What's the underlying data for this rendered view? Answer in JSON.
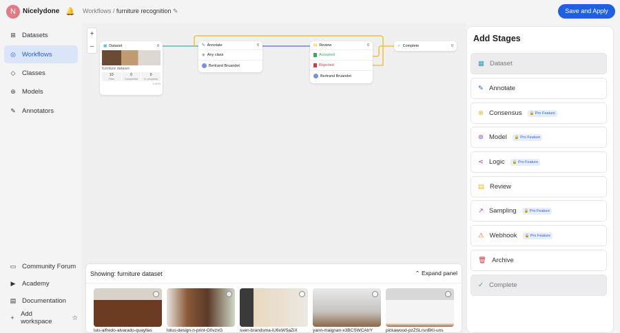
{
  "header": {
    "avatar": "N",
    "org": "Nicelydone",
    "crumb_root": "Workflows /",
    "crumb_current": "furniture recognition",
    "save": "Save and Apply"
  },
  "sidebar": {
    "items": [
      {
        "label": "Datasets",
        "icon": "⊞"
      },
      {
        "label": "Workflows",
        "icon": "◎"
      },
      {
        "label": "Classes",
        "icon": "◇"
      },
      {
        "label": "Models",
        "icon": "⊛"
      },
      {
        "label": "Annotators",
        "icon": "✎"
      }
    ],
    "bottom": [
      {
        "label": "Community Forum",
        "icon": "▭"
      },
      {
        "label": "Academy",
        "icon": "▶"
      },
      {
        "label": "Documentation",
        "icon": "▤"
      },
      {
        "label": "Add workspace",
        "icon": "+"
      }
    ]
  },
  "canvas": {
    "zoom_in": "+",
    "zoom_out": "–",
    "dataset": {
      "title": "Dataset",
      "count": "0",
      "name": "furniture dataset",
      "stats": [
        {
          "v": "10",
          "l": "Files"
        },
        {
          "v": "0",
          "l": "Completed"
        },
        {
          "v": "0",
          "l": "In progress"
        }
      ],
      "progress": "0.00%"
    },
    "annotate": {
      "title": "Annotate",
      "count": "0",
      "class": "Any class",
      "user": "Bertrand Bruandet"
    },
    "review": {
      "title": "Review",
      "count": "0",
      "accepted": "Accepted",
      "rejected": "Rejected",
      "user": "Bertrand Bruandet"
    },
    "complete": {
      "title": "Complete",
      "count": "0"
    }
  },
  "panel": {
    "showing": "Showing:",
    "dataset": "furniture dataset",
    "expand": "Expand panel",
    "files": [
      "luis-alfredo-alvarado-quayllas",
      "lotus-design-n-print-O0vzxG",
      "sven-brandsma-iU6xWSaZiX",
      "yann-maignan-x3BCSWCAtrY",
      "pickawood-pzZSLrsnBKl-uns"
    ]
  },
  "stages": {
    "title": "Add Stages",
    "pro": "Pro Feature",
    "items": [
      {
        "label": "Dataset",
        "color": "#2aa0b8",
        "pro": false
      },
      {
        "label": "Annotate",
        "color": "#2b5ed8",
        "pro": false
      },
      {
        "label": "Consensus",
        "color": "#e8b82a",
        "pro": true
      },
      {
        "label": "Model",
        "color": "#8a44d8",
        "pro": true
      },
      {
        "label": "Logic",
        "color": "#c23ad0",
        "pro": true
      },
      {
        "label": "Review",
        "color": "#e8b82a",
        "pro": false
      },
      {
        "label": "Sampling",
        "color": "#c23ad0",
        "pro": true
      },
      {
        "label": "Webhook",
        "color": "#e8703a",
        "pro": true
      },
      {
        "label": "Archive",
        "color": "#d83a3a",
        "pro": false
      },
      {
        "label": "Complete",
        "color": "#3aa85a",
        "pro": false
      }
    ]
  }
}
